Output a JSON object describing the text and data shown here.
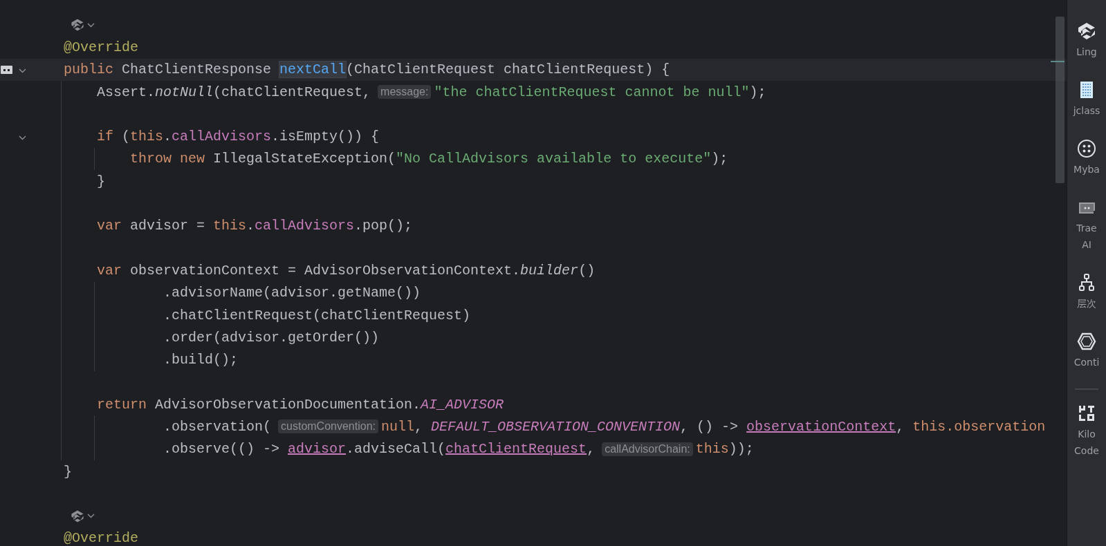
{
  "editor": {
    "lines": [
      {
        "kind": "lens",
        "current": false
      },
      {
        "kind": "code",
        "current": false,
        "segments": [
          {
            "kind": "code",
            "tokens": [
              {
                "kind": "ann",
                "text": "@Override"
              }
            ]
          }
        ]
      },
      {
        "kind": "code",
        "current": true,
        "gutter": [
          {
            "kind": "marker"
          },
          {
            "kind": "fold"
          }
        ],
        "segments": [
          {
            "kind": "code",
            "tokens": [
              {
                "kind": "kw",
                "text": "public "
              },
              {
                "kind": "plain",
                "text": "ChatClientResponse "
              },
              {
                "kind": "decl",
                "text": "nextCall"
              },
              {
                "kind": "plain",
                "text": "(ChatClientRequest chatClientRequest) {"
              }
            ]
          }
        ],
        "children": [
          {
            "kind": "code",
            "current": false,
            "segments": [
              {
                "kind": "code",
                "tokens": [
                  {
                    "kind": "plain",
                    "text": "Assert."
                  },
                  {
                    "kind": "italic",
                    "text": "notNull"
                  },
                  {
                    "kind": "plain",
                    "text": "(chatClientRequest,"
                  }
                ]
              },
              {
                "kind": "hint",
                "text": "message:"
              },
              {
                "kind": "code",
                "tokens": [
                  {
                    "kind": "str",
                    "text": "\"the chatClientRequest cannot be null\""
                  },
                  {
                    "kind": "plain",
                    "text": ");"
                  }
                ]
              }
            ]
          },
          {
            "kind": "code",
            "current": false
          },
          {
            "kind": "code",
            "current": false,
            "gutter": [
              {
                "kind": "fold"
              }
            ],
            "segments": [
              {
                "kind": "code",
                "tokens": [
                  {
                    "kind": "kw",
                    "text": "if "
                  },
                  {
                    "kind": "plain",
                    "text": "("
                  },
                  {
                    "kind": "kw",
                    "text": "this"
                  },
                  {
                    "kind": "plain",
                    "text": "."
                  },
                  {
                    "kind": "field",
                    "text": "callAdvisors"
                  },
                  {
                    "kind": "plain",
                    "text": ".isEmpty()) {"
                  }
                ]
              }
            ],
            "children": [
              {
                "kind": "code",
                "current": false,
                "segments": [
                  {
                    "kind": "code",
                    "tokens": [
                      {
                        "kind": "kw",
                        "text": "throw new "
                      },
                      {
                        "kind": "plain",
                        "text": "IllegalStateException("
                      },
                      {
                        "kind": "str",
                        "text": "\"No CallAdvisors available to execute\""
                      },
                      {
                        "kind": "plain",
                        "text": ");"
                      }
                    ]
                  }
                ]
              }
            ]
          },
          {
            "kind": "code",
            "current": false,
            "segments": [
              {
                "kind": "code",
                "tokens": [
                  {
                    "kind": "plain",
                    "text": "}"
                  }
                ]
              }
            ]
          },
          {
            "kind": "code",
            "current": false
          },
          {
            "kind": "code",
            "current": false,
            "segments": [
              {
                "kind": "code",
                "tokens": [
                  {
                    "kind": "kw",
                    "text": "var "
                  },
                  {
                    "kind": "plain",
                    "text": "advisor = "
                  },
                  {
                    "kind": "kw",
                    "text": "this"
                  },
                  {
                    "kind": "plain",
                    "text": "."
                  },
                  {
                    "kind": "field",
                    "text": "callAdvisors"
                  },
                  {
                    "kind": "plain",
                    "text": ".pop();"
                  }
                ]
              }
            ]
          },
          {
            "kind": "code",
            "current": false
          },
          {
            "kind": "code",
            "current": false,
            "segments": [
              {
                "kind": "code",
                "tokens": [
                  {
                    "kind": "kw",
                    "text": "var "
                  },
                  {
                    "kind": "plain",
                    "text": "observationContext = AdvisorObservationContext."
                  },
                  {
                    "kind": "italic",
                    "text": "builder"
                  },
                  {
                    "kind": "plain",
                    "text": "()"
                  }
                ]
              }
            ],
            "children": [
              {
                "kind": "continuation",
                "current": false,
                "segments": [
                  {
                    "kind": "code",
                    "tokens": [
                      {
                        "kind": "plain",
                        "text": ".advisorName(advisor.getName())"
                      }
                    ]
                  }
                ]
              },
              {
                "kind": "continuation",
                "current": false,
                "segments": [
                  {
                    "kind": "code",
                    "tokens": [
                      {
                        "kind": "plain",
                        "text": ".chatClientRequest(chatClientRequest)"
                      }
                    ]
                  }
                ]
              },
              {
                "kind": "continuation",
                "current": false,
                "segments": [
                  {
                    "kind": "code",
                    "tokens": [
                      {
                        "kind": "plain",
                        "text": ".order(advisor.getOrder())"
                      }
                    ]
                  }
                ]
              },
              {
                "kind": "continuation",
                "current": false,
                "segments": [
                  {
                    "kind": "code",
                    "tokens": [
                      {
                        "kind": "plain",
                        "text": ".build();"
                      }
                    ]
                  }
                ]
              }
            ]
          },
          {
            "kind": "code",
            "current": false
          },
          {
            "kind": "code",
            "current": false,
            "segments": [
              {
                "kind": "code",
                "tokens": [
                  {
                    "kind": "kw",
                    "text": "return "
                  },
                  {
                    "kind": "plain",
                    "text": "AdvisorObservationDocumentation."
                  },
                  {
                    "kind": "constant",
                    "text": "AI_ADVISOR"
                  }
                ]
              }
            ],
            "children": [
              {
                "kind": "continuation",
                "current": false,
                "segments": [
                  {
                    "kind": "code",
                    "tokens": [
                      {
                        "kind": "plain",
                        "text": ".observation("
                      }
                    ]
                  },
                  {
                    "kind": "hint",
                    "text": "customConvention:"
                  },
                  {
                    "kind": "code",
                    "tokens": [
                      {
                        "kind": "kw",
                        "text": "null"
                      },
                      {
                        "kind": "plain",
                        "text": ", "
                      },
                      {
                        "kind": "constant",
                        "text": "DEFAULT_OBSERVATION_CONVENTION"
                      },
                      {
                        "kind": "plain",
                        "text": ", () -> "
                      },
                      {
                        "kind": "captured",
                        "text": "observationContext"
                      },
                      {
                        "kind": "plain",
                        "text": ", "
                      },
                      {
                        "kind": "kw",
                        "text": "this.observation"
                      }
                    ]
                  }
                ]
              },
              {
                "kind": "continuation",
                "current": false,
                "segments": [
                  {
                    "kind": "code",
                    "tokens": [
                      {
                        "kind": "plain",
                        "text": ".observe(() -> "
                      },
                      {
                        "kind": "captured",
                        "text": "advisor"
                      },
                      {
                        "kind": "plain",
                        "text": ".adviseCall("
                      },
                      {
                        "kind": "captured",
                        "text": "chatClientRequest"
                      },
                      {
                        "kind": "plain",
                        "text": ","
                      }
                    ]
                  },
                  {
                    "kind": "hint",
                    "text": "callAdvisorChain:"
                  },
                  {
                    "kind": "code",
                    "tokens": [
                      {
                        "kind": "kw",
                        "text": "this"
                      },
                      {
                        "kind": "plain",
                        "text": "));"
                      }
                    ]
                  }
                ]
              }
            ]
          }
        ]
      },
      {
        "kind": "code",
        "current": false,
        "segments": [
          {
            "kind": "code",
            "tokens": [
              {
                "kind": "plain",
                "text": "}"
              }
            ]
          }
        ]
      },
      {
        "kind": "code",
        "current": false
      },
      {
        "kind": "lens",
        "current": false
      },
      {
        "kind": "code",
        "current": false,
        "segments": [
          {
            "kind": "code",
            "tokens": [
              {
                "kind": "ann",
                "text": "@Override"
              }
            ]
          }
        ]
      }
    ]
  },
  "tool_windows": [
    {
      "label": "Ling"
    },
    {
      "label": "jclass"
    },
    {
      "label": "Myba"
    },
    {
      "label": "Trae AI"
    },
    {
      "label": "层次"
    },
    {
      "label": "Conti"
    }
  ],
  "tool_windows_bottom": [
    {
      "label": "Kilo Code"
    }
  ]
}
